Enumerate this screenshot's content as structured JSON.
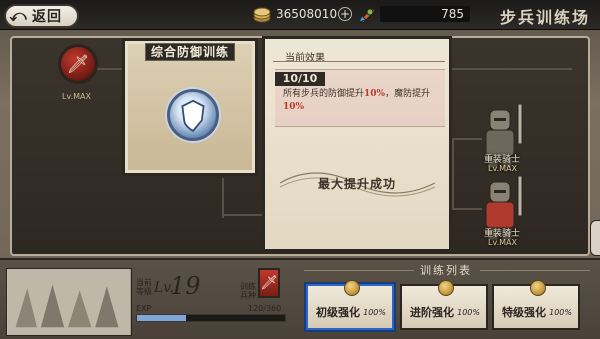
{
  "topbar": {
    "back_label": "返回",
    "gold_value": "36508010",
    "plus": "+",
    "gem_value": "785",
    "page_title": "步兵训练场"
  },
  "map": {
    "node_left_level": "Lv.MAX",
    "soldier_a_name": "重装骑士",
    "soldier_a_level": "Lv.MAX",
    "soldier_b_name": "重装骑士",
    "soldier_b_level": "Lv.MAX"
  },
  "card": {
    "title": "综合防御训练"
  },
  "effect": {
    "header": "当前效果",
    "count": "10/10",
    "text_before_1": "所有步兵的防御提升",
    "value_1": "10%",
    "text_middle": "，魔防提升",
    "value_2": "10%",
    "result": "最大提升成功"
  },
  "bottom": {
    "lv_label_top": "当前",
    "lv_label_bottom": "等级",
    "lv_prefix": "Lv.",
    "level": "19",
    "train_label_top": "训练",
    "train_label_bottom": "兵种",
    "exp_label": "EXP",
    "exp_value": "120/360",
    "exp_progress": 0.333,
    "list_title": "训练列表",
    "options": [
      {
        "label": "初级强化",
        "pct": "100%"
      },
      {
        "label": "进阶强化",
        "pct": "100%"
      },
      {
        "label": "特级强化",
        "pct": "100%"
      }
    ]
  },
  "icons": {
    "back": "arrow-back-icon",
    "gold": "gold-coin-icon",
    "gem": "gem-icon",
    "sword": "sword-icon",
    "shield": "shield-emblem-icon"
  }
}
